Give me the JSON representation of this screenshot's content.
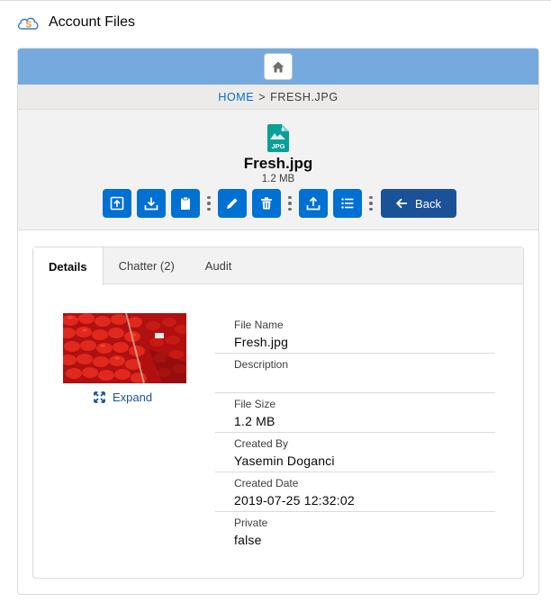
{
  "app": {
    "title": "Account Files"
  },
  "breadcrumb": {
    "home": "HOME",
    "separator": ">",
    "current": "FRESH.JPG"
  },
  "file": {
    "type_badge": "JPG",
    "name": "Fresh.jpg",
    "size": "1.2 MB"
  },
  "toolbar": {
    "buttons": [
      {
        "icon": "open-icon"
      },
      {
        "icon": "download-icon"
      },
      {
        "icon": "clipboard-icon"
      },
      {
        "icon": "edit-icon"
      },
      {
        "icon": "trash-icon"
      },
      {
        "icon": "upload-icon"
      },
      {
        "icon": "list-icon"
      }
    ],
    "back_label": "Back"
  },
  "tabs": [
    {
      "label": "Details",
      "active": true
    },
    {
      "label": "Chatter (2)",
      "active": false
    },
    {
      "label": "Audit",
      "active": false
    }
  ],
  "preview": {
    "expand_label": "Expand"
  },
  "details": [
    {
      "label": "File Name",
      "value": "Fresh.jpg"
    },
    {
      "label": "Description",
      "value": ""
    },
    {
      "label": "File Size",
      "value": "1.2 MB"
    },
    {
      "label": "Created By",
      "value": "Yasemin Doganci"
    },
    {
      "label": "Created Date",
      "value": "2019-07-25 12:32:02"
    },
    {
      "label": "Private",
      "value": "false"
    }
  ],
  "colors": {
    "topbar": "#76a9dd",
    "action_button": "#0070d2",
    "back_button": "#1b5297",
    "link": "#0070d2",
    "file_icon": "#0a9f97"
  }
}
